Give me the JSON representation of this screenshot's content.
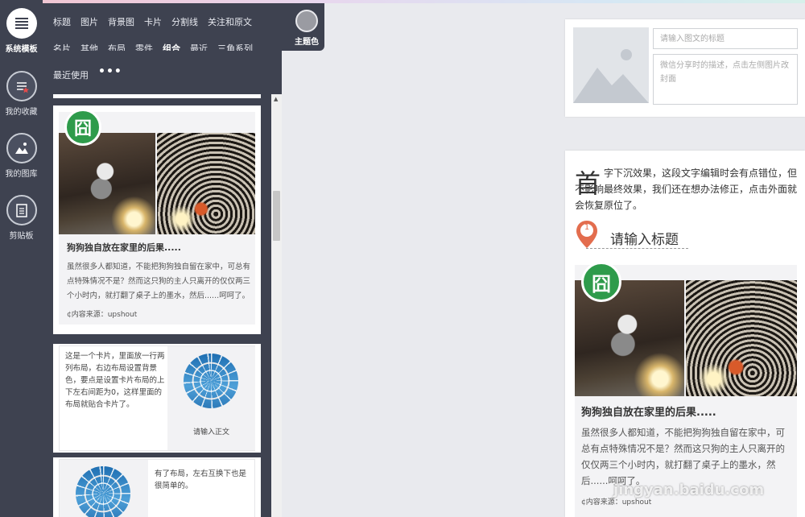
{
  "rail": {
    "items": [
      {
        "label": "系统模板",
        "icon": "template-list-icon"
      },
      {
        "label": "我的收藏",
        "icon": "favorites-icon"
      },
      {
        "label": "我的图库",
        "icon": "gallery-icon"
      },
      {
        "label": "剪贴板",
        "icon": "clipboard-icon"
      }
    ]
  },
  "categories": {
    "row1": [
      "标题",
      "图片",
      "背景图",
      "卡片",
      "分割线",
      "关注和原文"
    ],
    "row2": [
      "名片",
      "其他",
      "布局",
      "零件",
      "组合",
      "最近",
      "三角系列"
    ],
    "row3": [
      "最近使用"
    ],
    "more": "•••",
    "active": "组合"
  },
  "theme": {
    "label": "主题色",
    "color": "#9a9ba2"
  },
  "templates": {
    "card1": {
      "badge": "囧",
      "title": "狗狗独自放在家里的后果.....",
      "body": "虽然很多人都知道，不能把狗狗独自留在家中，可总有点特殊情况不是？然而这只狗的主人只离开的仅仅两三个小时内，就打翻了桌子上的墨水，然后......呵呵了。",
      "source": "¢内容来源：upshout"
    },
    "card2": {
      "text": "这是一个卡片，里面放一行两列布局，右边布局设置背景色，要点是设置卡片布局的上下左右间距为0，这样里面的布局就贴合卡片了。",
      "caption": "请输入正文"
    },
    "card3": {
      "text": "有了布局，左右互换下也是很简单的。"
    }
  },
  "editor": {
    "title_placeholder": "请输入图文的标题",
    "desc_placeholder": "微信分享时的描述，点击左侧图片改封面",
    "dropcap": "首",
    "dropcap_text": "字下沉效果，这段文字编辑时会有点错位，但不影响最终效果，我们还在想办法修正，点击外面就会恢复原位了。",
    "pin_number": "1",
    "heading_placeholder": "请输入标题",
    "badge": "囧",
    "card_title": "狗狗独自放在家里的后果.....",
    "card_body": "虽然很多人都知道，不能把狗狗独自留在家中，可总有点特殊情况不是？然而这只狗的主人只离开的仅仅两三个小时内，就打翻了桌子上的墨水，然后......呵呵了。",
    "card_source": "¢内容来源：upshout"
  },
  "watermark": "jingyan.baidu.com",
  "colors": {
    "rail": "#3e4250",
    "badge": "#2e9b4b",
    "pin": "#e36d4e"
  }
}
